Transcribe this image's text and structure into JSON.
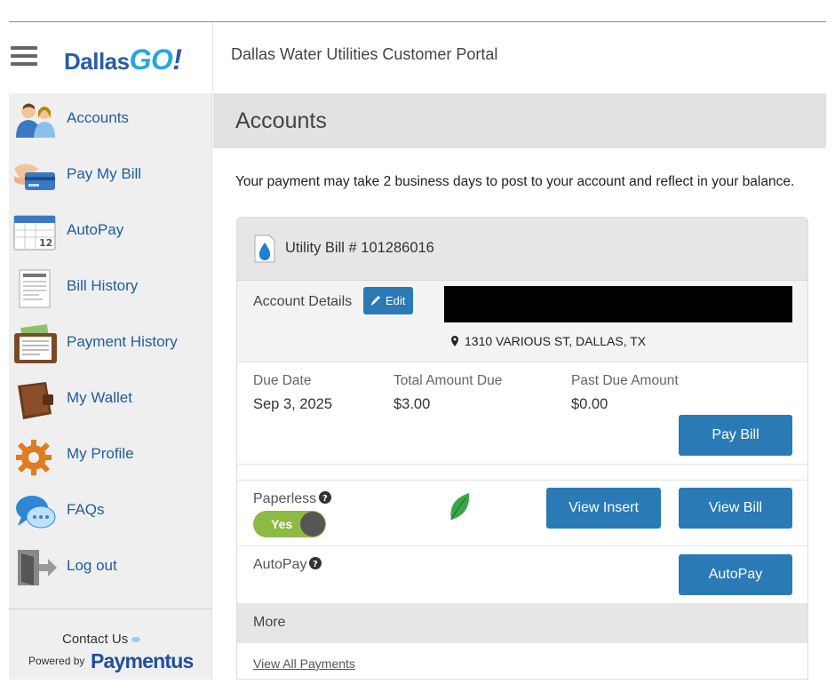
{
  "header": {
    "logo_text_dallas": "Dallas",
    "logo_text_go": "GO",
    "logo_text_bang": "!",
    "portal_title": "Dallas Water Utilities Customer Portal"
  },
  "sidebar": {
    "items": [
      {
        "label": "Accounts",
        "icon": "people-icon"
      },
      {
        "label": "Pay My Bill",
        "icon": "card-payment-icon"
      },
      {
        "label": "AutoPay",
        "icon": "calendar-icon"
      },
      {
        "label": "Bill History",
        "icon": "invoice-icon"
      },
      {
        "label": "Payment History",
        "icon": "wallet-cash-icon"
      },
      {
        "label": "My Wallet",
        "icon": "wallet-icon"
      },
      {
        "label": "My Profile",
        "icon": "gear-icon"
      },
      {
        "label": "FAQs",
        "icon": "chat-bubble-icon"
      },
      {
        "label": "Log out",
        "icon": "logout-icon"
      }
    ],
    "contact_label": "Contact Us",
    "powered_by": "Powered by",
    "brand": "Paymentus",
    "calendar_day": "12"
  },
  "main": {
    "page_title": "Accounts",
    "notice": "Your payment may take 2 business days to post to your account and reflect in your balance."
  },
  "card": {
    "title": "Utility Bill # 101286016",
    "account_details_label": "Account Details",
    "edit_label": "Edit",
    "address": "1310 VARIOUS ST, DALLAS, TX",
    "due_date_label": "Due Date",
    "due_date": "Sep 3, 2025",
    "total_due_label": "Total Amount Due",
    "total_due": "$3.00",
    "past_due_label": "Past Due Amount",
    "past_due": "$0.00",
    "pay_bill_label": "Pay Bill",
    "paperless_label": "Paperless",
    "paperless_toggle": "Yes",
    "view_insert_label": "View Insert",
    "view_bill_label": "View Bill",
    "autopay_label": "AutoPay",
    "autopay_button": "AutoPay",
    "more_label": "More",
    "view_all_payments": "View All Payments"
  },
  "colors": {
    "accent": "#2a7ab6",
    "link": "#1f5d9e",
    "toggle_on": "#8dba44",
    "sidebar_bg": "#efefef"
  }
}
